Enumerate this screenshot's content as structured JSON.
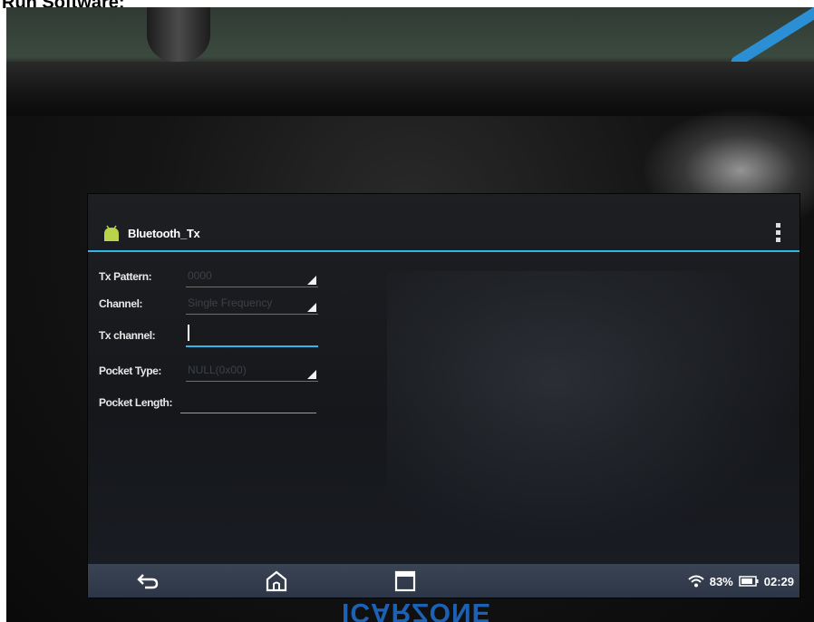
{
  "heading": "Run Software:",
  "app": {
    "title": "Bluetooth_Tx",
    "accent_color": "#33b5e5",
    "icon": "android-icon",
    "menu_icon": "overflow-menu-icon"
  },
  "form": {
    "tx_pattern": {
      "label": "Tx Pattern:",
      "value": "0000"
    },
    "channel": {
      "label": "Channel:",
      "value": "Single Frequency"
    },
    "tx_channel": {
      "label": "Tx channel:",
      "value": ""
    },
    "pocket_type": {
      "label": "Pocket Type:",
      "value": "NULL(0x00)"
    },
    "pocket_length": {
      "label": "Pocket Length:",
      "value": ""
    }
  },
  "nav": {
    "back_icon": "back-icon",
    "home_icon": "home-icon",
    "recents_icon": "recents-icon"
  },
  "status": {
    "wifi_icon": "wifi-icon",
    "battery_percent": "83%",
    "battery_icon": "battery-icon",
    "time": "02:29"
  },
  "brand": "ICARZONE"
}
